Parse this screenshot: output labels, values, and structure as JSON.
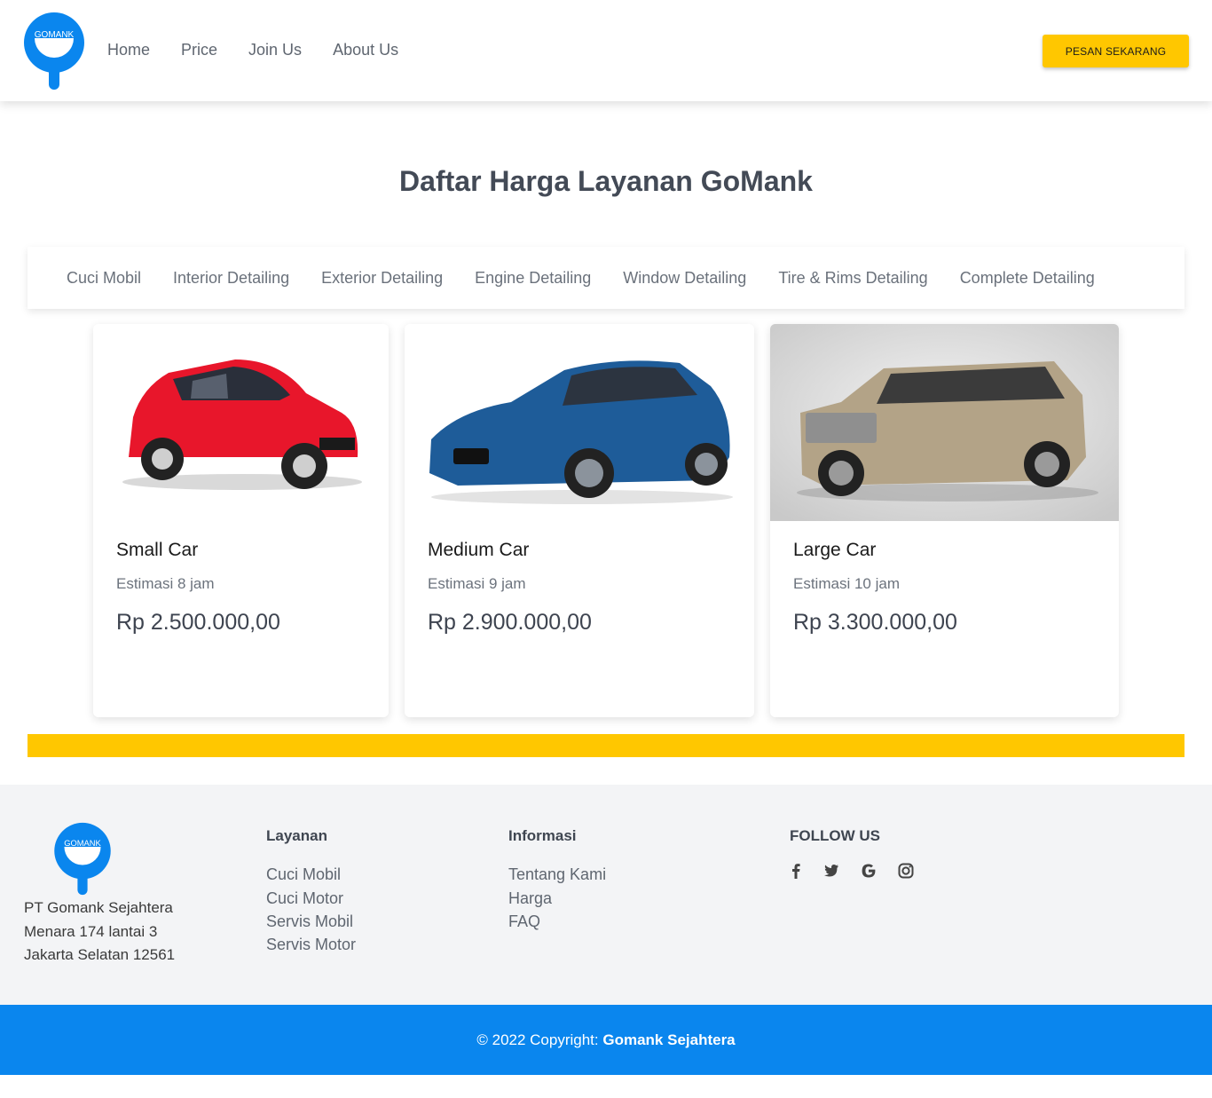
{
  "brand": {
    "logo_text": "GOMANK",
    "blue": "#0a86ee",
    "yellow": "#ffc700"
  },
  "nav": {
    "links": [
      "Home",
      "Price",
      "Join Us",
      "About Us"
    ],
    "cta": "PESAN SEKARANG"
  },
  "page_title": "Daftar Harga Layanan GoMank",
  "tabs": [
    "Cuci Mobil",
    "Interior Detailing",
    "Exterior Detailing",
    "Engine Detailing",
    "Window Detailing",
    "Tire & Rims Detailing",
    "Complete Detailing"
  ],
  "cards": [
    {
      "name": "Small Car",
      "estimate": "Estimasi 8 jam",
      "price": "Rp 2.500.000,00",
      "car_color": "red"
    },
    {
      "name": "Medium Car",
      "estimate": "Estimasi 9 jam",
      "price": "Rp 2.900.000,00",
      "car_color": "blue"
    },
    {
      "name": "Large Car",
      "estimate": "Estimasi 10 jam",
      "price": "Rp 3.300.000,00",
      "car_color": "beige"
    }
  ],
  "footer": {
    "address": [
      "PT Gomank Sejahtera",
      "Menara 174 lantai 3",
      "Jakarta Selatan 12561"
    ],
    "layanan_title": "Layanan",
    "layanan_links": [
      "Cuci Mobil",
      "Cuci Motor",
      "Servis Mobil",
      "Servis Motor"
    ],
    "informasi_title": "Informasi",
    "informasi_links": [
      "Tentang Kami",
      "Harga",
      "FAQ"
    ],
    "follow_title": "FOLLOW US",
    "social_icons": [
      "facebook-icon",
      "twitter-icon",
      "google-icon",
      "instagram-icon"
    ]
  },
  "copyright": {
    "prefix": "© 2022 Copyright: ",
    "company": "Gomank Sejahtera"
  }
}
